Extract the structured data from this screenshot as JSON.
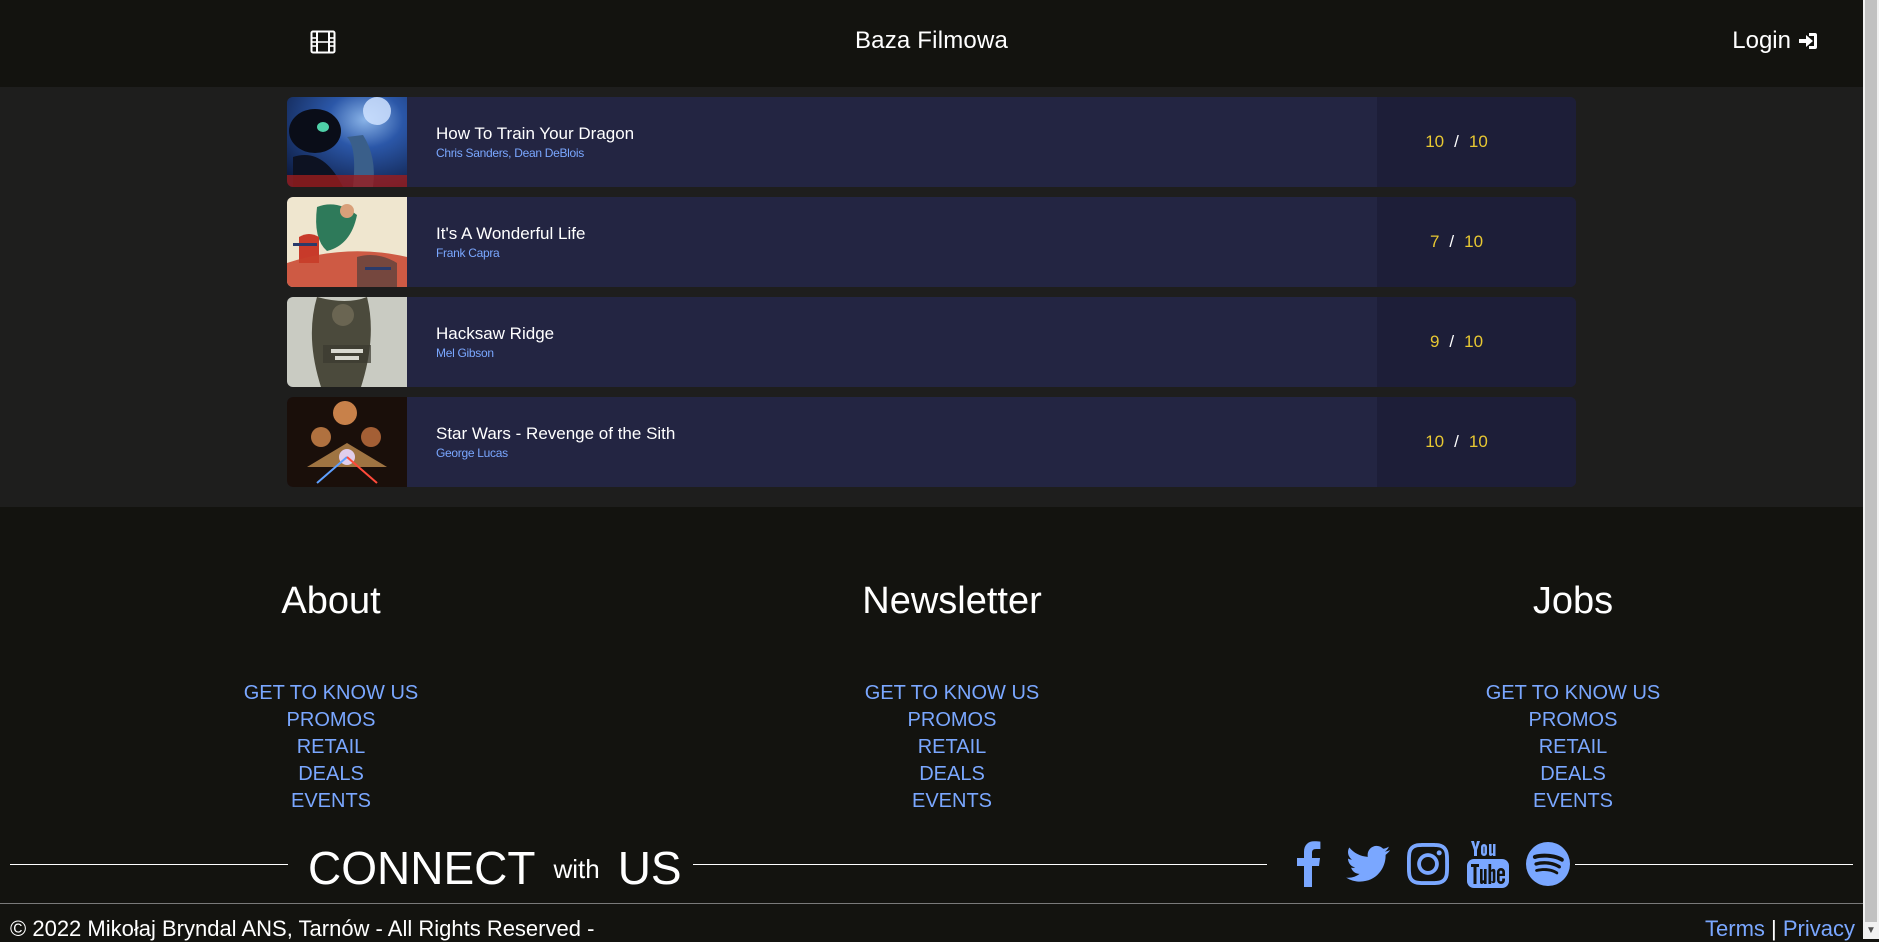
{
  "header": {
    "brand": "Baza Filmowa",
    "login_label": "Login"
  },
  "movies": [
    {
      "title": "How To Train Your Dragon",
      "director": "Chris Sanders, Dean DeBlois",
      "rating": "10",
      "max": "10"
    },
    {
      "title": "It's A Wonderful Life",
      "director": "Frank Capra",
      "rating": "7",
      "max": "10"
    },
    {
      "title": "Hacksaw Ridge",
      "director": "Mel Gibson",
      "rating": "9",
      "max": "10"
    },
    {
      "title": "Star Wars - Revenge of the Sith",
      "director": "George Lucas",
      "rating": "10",
      "max": "10"
    }
  ],
  "rating_separator": "/",
  "footer": {
    "columns": [
      {
        "heading": "About",
        "links": [
          "GET TO KNOW US",
          "PROMOS",
          "RETAIL",
          "DEALS",
          "EVENTS"
        ]
      },
      {
        "heading": "Newsletter",
        "links": [
          "GET TO KNOW US",
          "PROMOS",
          "RETAIL",
          "DEALS",
          "EVENTS"
        ]
      },
      {
        "heading": "Jobs",
        "links": [
          "GET TO KNOW US",
          "PROMOS",
          "RETAIL",
          "DEALS",
          "EVENTS"
        ]
      }
    ],
    "connect": {
      "word1": "CONNECT",
      "word2": "with",
      "word3": "US"
    },
    "socials": [
      "facebook-icon",
      "twitter-icon",
      "instagram-icon",
      "youtube-icon",
      "spotify-icon"
    ],
    "copyright": "2022 Mikołaj Bryndal ANS, Tarnów - All Rights Reserved -",
    "terms": "Terms",
    "privacy": "Privacy",
    "link_separator": "|"
  },
  "colors": {
    "background": "#13130f",
    "list_background": "#1e1e1d",
    "card": "#232542",
    "rating_panel": "#1d1e38",
    "accent_link": "#7aa7ff",
    "rating_text": "#e8c832"
  }
}
